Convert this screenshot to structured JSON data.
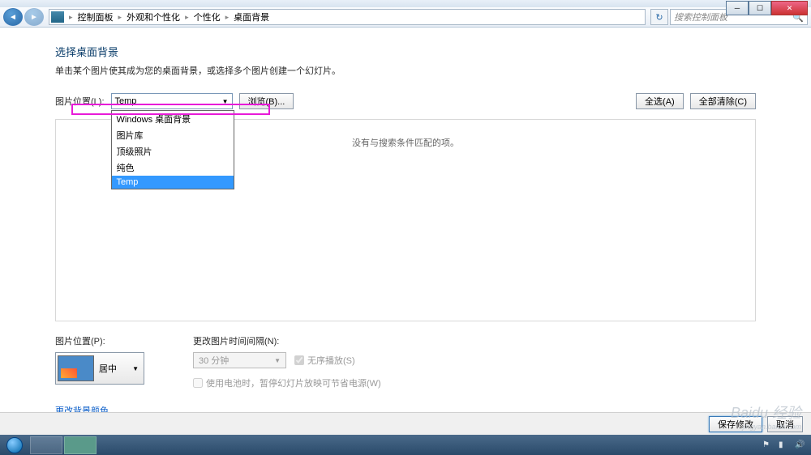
{
  "window": {
    "min": "─",
    "max": "☐",
    "close": "✕"
  },
  "nav": {
    "back": "◄",
    "fwd": "►",
    "refresh": "↻",
    "breadcrumb": [
      "控制面板",
      "外观和个性化",
      "个性化",
      "桌面背景"
    ],
    "search_placeholder": "搜索控制面板"
  },
  "page": {
    "title": "选择桌面背景",
    "subtitle": "单击某个图片使其成为您的桌面背景，或选择多个图片创建一个幻灯片。"
  },
  "location": {
    "label": "图片位置(L):",
    "selected": "Temp",
    "options": [
      "Windows 桌面背景",
      "图片库",
      "顶级照片",
      "纯色",
      "Temp"
    ],
    "browse": "浏览(B)..."
  },
  "actions": {
    "select_all": "全选(A)",
    "clear_all": "全部清除(C)"
  },
  "list_empty": "没有与搜索条件匹配的项。",
  "position": {
    "label": "图片位置(P):",
    "value": "居中"
  },
  "interval": {
    "label": "更改图片时间间隔(N):",
    "value": "30 分钟",
    "shuffle": "无序播放(S)",
    "battery": "使用电池时，暂停幻灯片放映可节省电源(W)"
  },
  "link_bg_color": "更改背景颜色",
  "footer": {
    "save": "保存修改",
    "cancel": "取消"
  },
  "watermark": {
    "brand": "Baidu 经验",
    "url": "jingyan.baidu.com"
  }
}
